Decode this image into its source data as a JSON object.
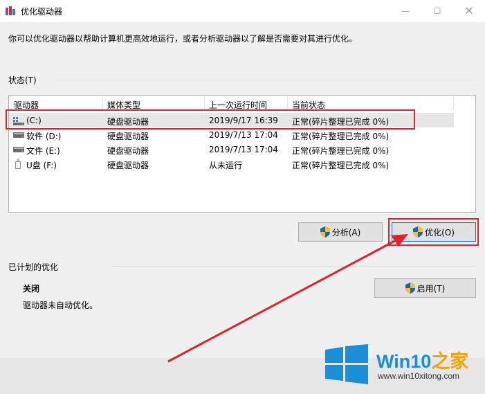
{
  "window": {
    "title": "优化驱动器"
  },
  "description": "你可以优化驱动器以帮助计算机更高效地运行，或者分析驱动器以了解是否需要对其进行优化。",
  "status": {
    "section_title": "状态(T)",
    "columns": [
      "驱动器",
      "媒体类型",
      "上一次运行时间",
      "当前状态"
    ],
    "rows": [
      {
        "drive": "(C:)",
        "media": "硬盘驱动器",
        "last_run": "2019/9/17 16:39",
        "state": "正常(碎片整理已完成 0%)",
        "icon": "windows-drive-icon",
        "selected": true
      },
      {
        "drive": "软件 (D:)",
        "media": "硬盘驱动器",
        "last_run": "2019/7/13 17:04",
        "state": "正常(碎片整理已完成 0%)",
        "icon": "hard-drive-icon",
        "selected": false
      },
      {
        "drive": "文件 (E:)",
        "media": "硬盘驱动器",
        "last_run": "2019/7/13 17:04",
        "state": "正常(碎片整理已完成 0%)",
        "icon": "hard-drive-icon",
        "selected": false
      },
      {
        "drive": "U盘 (F:)",
        "media": "硬盘驱动器",
        "last_run": "从未运行",
        "state": "正常(碎片整理已完成 0%)",
        "icon": "usb-drive-icon",
        "selected": false
      }
    ],
    "analyze_label": "分析(A)",
    "optimize_label": "优化(O)"
  },
  "scheduled": {
    "section_title": "已计划的优化",
    "state_title": "关闭",
    "state_desc": "驱动器未自动优化。",
    "enable_label": "启用(T)"
  },
  "watermark": {
    "brand": "Win10",
    "brand_suffix": "之家",
    "url": "www.win10xitong.com"
  },
  "colors": {
    "annotation_red": "#e0222a",
    "selection": "#e6e6e6",
    "win_blue": "#1a8fd8"
  }
}
